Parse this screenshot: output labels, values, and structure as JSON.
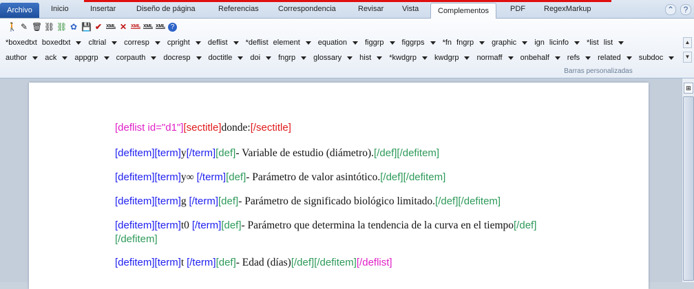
{
  "tabs": {
    "archivo": "Archivo",
    "inicio": "Inicio",
    "insertar": "Insertar",
    "diseno": "Diseño de página",
    "referencias": "Referencias",
    "correspondencia": "Correspondencia",
    "revisar": "Revisar",
    "vista": "Vista",
    "complementos": "Complementos",
    "pdf": "PDF",
    "regex": "RegexMarkup"
  },
  "toolbar_icons": [
    "person-icon",
    "pencil-icon",
    "trash-icon",
    "link-icon",
    "link-color-icon",
    "palette-icon",
    "save-icon",
    "check-icon",
    "xml-icon",
    "close-icon",
    "xml-delete-icon",
    "xml-check-icon",
    "xml-file-icon",
    "help-icon"
  ],
  "toolbar_icon_text": {
    "xml": "XML",
    "xml2": "XML",
    "xml3": "XML",
    "xml4": "XML"
  },
  "row1": [
    "*boxedtxt",
    "boxedtxt",
    "cltrial",
    "corresp",
    "cpright",
    "deflist",
    "*deflist",
    "element",
    "equation",
    "figgrp",
    "figgrps",
    "*fn",
    "fngrp",
    "graphic",
    "ign",
    "licinfo",
    "*list",
    "list"
  ],
  "row1_arrows_after": [
    1,
    2,
    3,
    4,
    5,
    7,
    8,
    9,
    10,
    12,
    13,
    15,
    17
  ],
  "row2": [
    "author",
    "ack",
    "appgrp",
    "corpauth",
    "docresp",
    "doctitle",
    "doi",
    "fngrp",
    "glossary",
    "hist",
    "*kwdgrp",
    "kwdgrp",
    "normaff",
    "onbehalf",
    "refs",
    "related",
    "subdoc"
  ],
  "group_label": "Barras personalizadas",
  "doc": {
    "p1": {
      "open": "[deflist id=\"d1\"]",
      "st_open": "[sectitle]",
      "text": "donde:",
      "st_close": "[/sectitle]"
    },
    "items": [
      {
        "term": "y",
        "def": "- Variable de estudio (diámetro)."
      },
      {
        "term": "y∞ ",
        "def": "- Parámetro de valor asintótico."
      },
      {
        "term": "g ",
        "def": "- Parámetro de significado biológico limitado."
      },
      {
        "term": "t0 ",
        "def": "- Parámetro que determina la tendencia de la curva en el tiempo"
      },
      {
        "term": "t ",
        "def": "- Edad (días)"
      }
    ],
    "tags": {
      "defitem": "[defitem]",
      "term": "[term]",
      "term_close": "[/term]",
      "def": "[def]",
      "def_close": "[/def]",
      "defitem_close": "[/defitem]",
      "deflist_close": "[/deflist]"
    }
  }
}
